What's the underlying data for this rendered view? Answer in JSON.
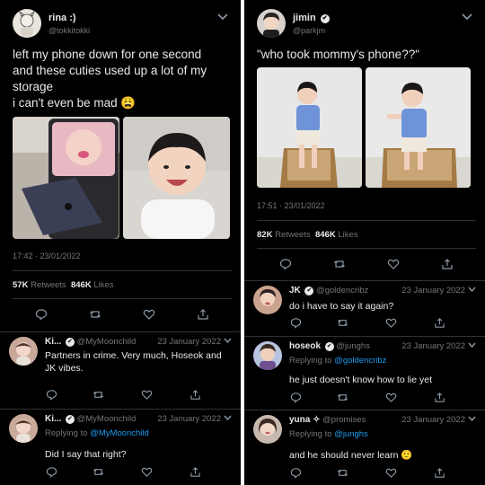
{
  "left": {
    "tweet": {
      "name": "rina :)",
      "handle": "@tokkitokki",
      "text": "left my phone down for one second\nand these cuties used up a lot of my\nstorage\ni can't even be mad 😩",
      "timestamp": "17:42 · 23/01/2022",
      "retweets": "57K",
      "retweets_label": "Retweets",
      "likes": "846K",
      "likes_label": "Likes"
    },
    "replies": [
      {
        "name": "Ki...",
        "handle": "@MyMoonchild",
        "date": "23 January 2022",
        "text": "Partners in crime. Very much, Hoseok\nand JK vibes."
      },
      {
        "name": "Ki...",
        "handle": "@MyMoonchild",
        "date": "23 January 2022",
        "replying_label": "Replying to",
        "replying_to": "@MyMoonchild",
        "text": "Did I say that right?"
      }
    ]
  },
  "right": {
    "tweet": {
      "name": "jimin",
      "handle": "@parkjm",
      "text": "\"who took mommy's phone??\"",
      "timestamp": "17:51 · 23/01/2022",
      "retweets": "82K",
      "retweets_label": "Retweets",
      "likes": "846K",
      "likes_label": "Likes"
    },
    "replies": [
      {
        "name": "JK",
        "handle": "@goldencribz",
        "date": "23 January 2022",
        "text": "do i have to say it again?"
      },
      {
        "name": "hoseok",
        "handle": "@junghs",
        "date": "23 January 2022",
        "replying_label": "Replying to",
        "replying_to": "@goldencribz",
        "text": "he just doesn't know how to lie yet"
      },
      {
        "name": "yuna ✧",
        "handle": "@promises",
        "date": "23 January 2022",
        "replying_label": "Replying to",
        "replying_to": "@junghs",
        "text": "and he should never learn 🙂"
      }
    ]
  },
  "icons": {
    "verified": "✔",
    "chevron": "⌵"
  },
  "colors": {
    "background": "#000000",
    "text": "#e7e9ea",
    "muted": "#71767b",
    "link": "#1d9bf0",
    "divider": "#2f3336"
  }
}
